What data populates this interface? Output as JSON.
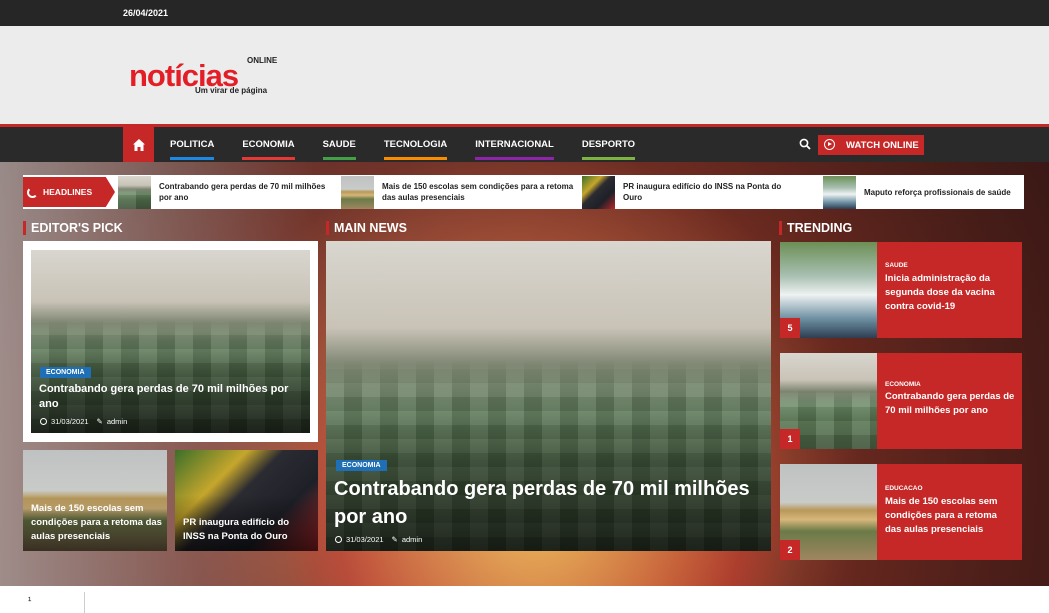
{
  "topbar": {
    "date": "26/04/2021"
  },
  "logo": {
    "online": "ONLINE",
    "word": "notícias",
    "tagline": "Um virar de página"
  },
  "nav": {
    "items": [
      {
        "label": "POLITICA",
        "color": "#1e88e5"
      },
      {
        "label": "ECONOMIA",
        "color": "#e53935"
      },
      {
        "label": "SAUDE",
        "color": "#43a047"
      },
      {
        "label": "TECNOLOGIA",
        "color": "#fb8c00"
      },
      {
        "label": "INTERNACIONAL",
        "color": "#8e24aa"
      },
      {
        "label": "DESPORTO",
        "color": "#7cb342"
      }
    ],
    "watch_label": "WATCH ONLINE"
  },
  "ticker": {
    "label": "HEADLINES",
    "items": [
      {
        "text": "Contrabando gera perdas de 70 mil milhões por ano"
      },
      {
        "text": "Mais de 150 escolas sem condições para a retoma das aulas presenciais"
      },
      {
        "text": "PR inaugura edifício do INSS na Ponta do Ouro"
      },
      {
        "text": "Maputo reforça profissionais de saúde"
      }
    ]
  },
  "sections": {
    "editors_pick": "EDITOR'S PICK",
    "main_news": "MAIN NEWS",
    "trending": "TRENDING"
  },
  "editors_pick": {
    "main": {
      "category": "ECONOMIA",
      "title": "Contrabando gera perdas de 70 mil milhões por ano",
      "date": "31/03/2021",
      "author": "admin"
    },
    "small": [
      {
        "title": "Mais de 150 escolas sem condições para a retoma das aulas presenciais"
      },
      {
        "title": "PR inaugura edifício do INSS na Ponta do Ouro"
      }
    ]
  },
  "main_news": {
    "category": "ECONOMIA",
    "title": "Contrabando gera perdas de 70 mil milhões por ano",
    "date": "31/03/2021",
    "author": "admin"
  },
  "trending": [
    {
      "category": "SAUDE",
      "title": "Inicia administração da segunda dose da vacina contra covid-19",
      "rank": "5"
    },
    {
      "category": "ECONOMIA",
      "title": "Contrabando gera perdas de 70 mil milhões por ano",
      "rank": "1"
    },
    {
      "category": "EDUCACAO",
      "title": "Mais de 150 escolas sem condições para a retoma das aulas presenciais",
      "rank": "2"
    }
  ],
  "footer": {
    "mark": "¹"
  }
}
